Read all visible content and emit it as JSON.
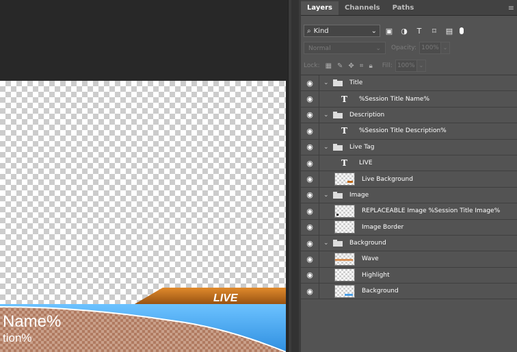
{
  "panel": {
    "tabs": [
      "Layers",
      "Channels",
      "Paths"
    ],
    "filter_kind": "Kind",
    "blend_mode": "Normal",
    "opacity_label": "Opacity:",
    "opacity_value": "100%",
    "lock_label": "Lock:",
    "fill_label": "Fill:",
    "fill_value": "100%"
  },
  "layers": [
    {
      "name": "Title",
      "type": "group"
    },
    {
      "name": "%Session Title Name%",
      "type": "text"
    },
    {
      "name": "Description",
      "type": "group"
    },
    {
      "name": "%Session Title Description%",
      "type": "text"
    },
    {
      "name": "Live Tag",
      "type": "group"
    },
    {
      "name": "LIVE",
      "type": "text"
    },
    {
      "name": "Live Background",
      "type": "pixel"
    },
    {
      "name": "Image",
      "type": "group"
    },
    {
      "name": "REPLACEABLE Image %Session Title Image%",
      "type": "pixel"
    },
    {
      "name": "Image Border",
      "type": "pixel"
    },
    {
      "name": "Background",
      "type": "group"
    },
    {
      "name": "Wave",
      "type": "pixel"
    },
    {
      "name": "Highlight",
      "type": "pixel"
    },
    {
      "name": "Background",
      "type": "pixel"
    }
  ],
  "canvas": {
    "live_text": "LIVE",
    "name_text": "Name%",
    "desc_text": "tion%"
  },
  "colors": {
    "orange": "#b8661a",
    "blue": "#4aa8ef",
    "brown": "#b9876e"
  }
}
